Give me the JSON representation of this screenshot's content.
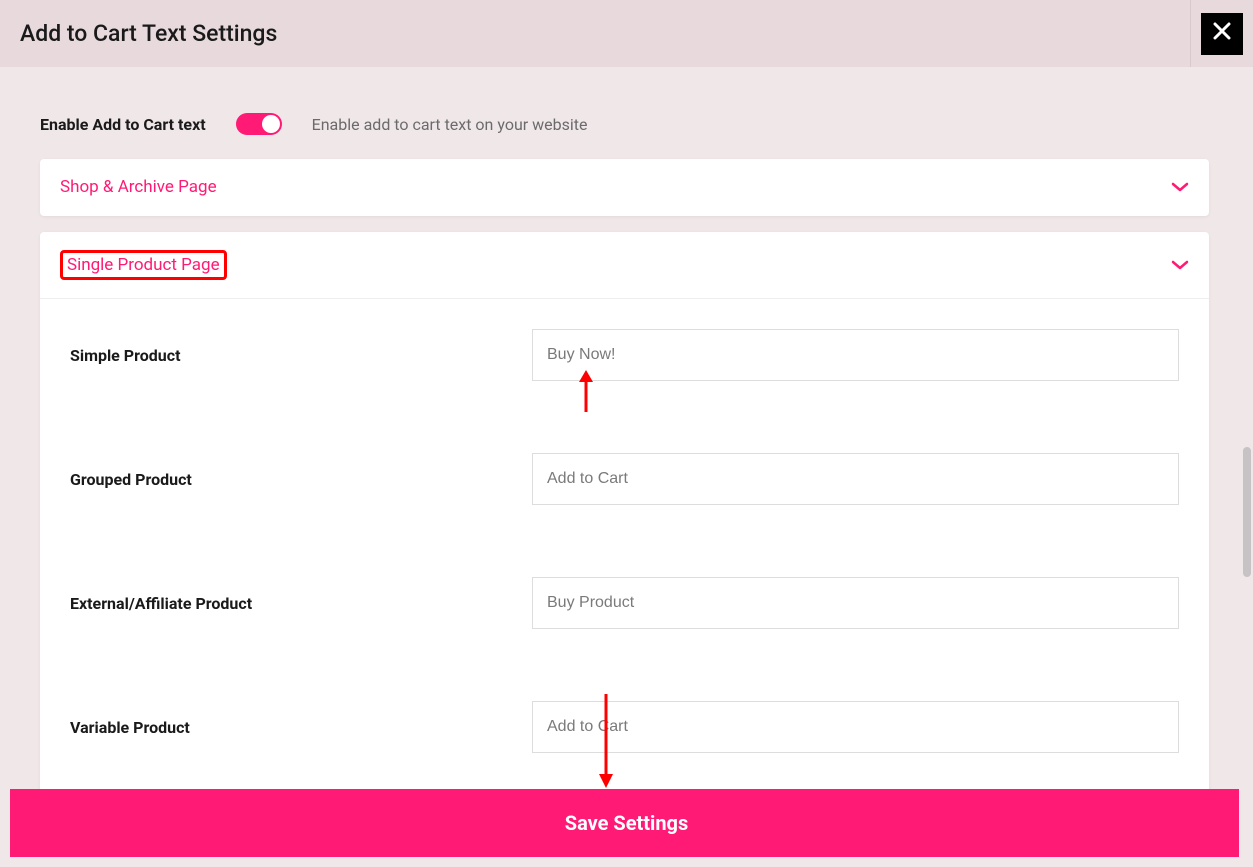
{
  "header": {
    "title": "Add to Cart Text Settings"
  },
  "enable": {
    "label": "Enable Add to Cart text",
    "description": "Enable add to cart text on your website",
    "state": "on"
  },
  "accordions": {
    "shop_archive": {
      "title": "Shop & Archive Page"
    },
    "single_product": {
      "title": "Single Product Page"
    }
  },
  "single_product_fields": {
    "simple": {
      "label": "Simple Product",
      "placeholder": "Buy Now!"
    },
    "grouped": {
      "label": "Grouped Product",
      "placeholder": "Add to Cart"
    },
    "external": {
      "label": "External/Affiliate Product",
      "placeholder": "Buy Product"
    },
    "variable": {
      "label": "Variable Product",
      "placeholder": "Add to Cart"
    }
  },
  "save": {
    "label": "Save Settings"
  }
}
